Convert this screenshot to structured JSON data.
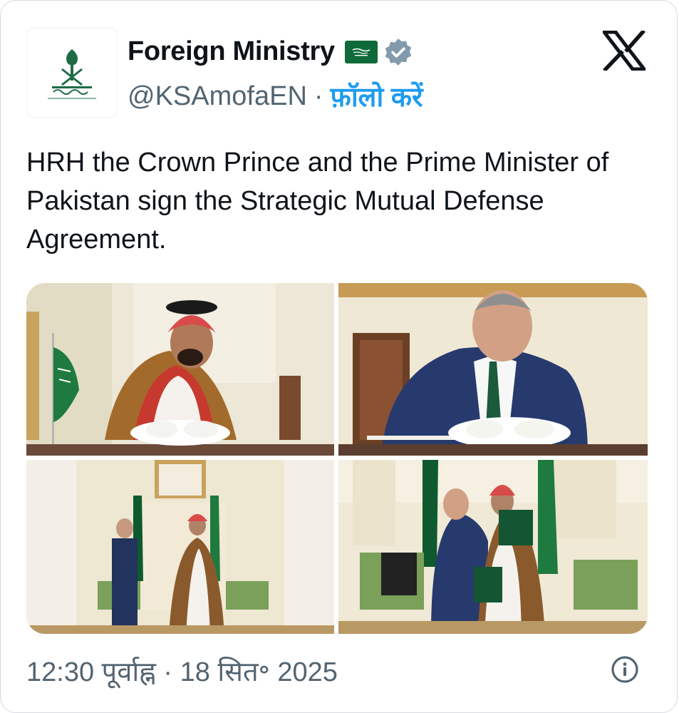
{
  "account": {
    "display_name": "Foreign Ministry",
    "handle": "@KSAmofaEN",
    "separator": "·",
    "follow_label": "फ़ॉलो करें",
    "avatar_icon": "saudi-emblem-icon",
    "flag_icon": "saudi-flag-icon",
    "verified_icon": "verified-badge-icon"
  },
  "platform_logo": "x-logo-icon",
  "tweet": {
    "text": "HRH the Crown Prince and the Prime Minister of Pakistan sign the Strategic Mutual Defense Agreement."
  },
  "photos": [
    {
      "label": "photo-crown-prince-signing"
    },
    {
      "label": "photo-prime-minister-signing"
    },
    {
      "label": "photo-handshake"
    },
    {
      "label": "photo-embrace"
    }
  ],
  "meta": {
    "timestamp": "12:30 पूर्वाह्न · 18 सित॰ 2025",
    "info_icon": "info-icon"
  },
  "colors": {
    "link": "#1d9bf0",
    "secondary_text": "#536471",
    "primary_text": "#0f1419",
    "saudi_green": "#0f6a39"
  }
}
